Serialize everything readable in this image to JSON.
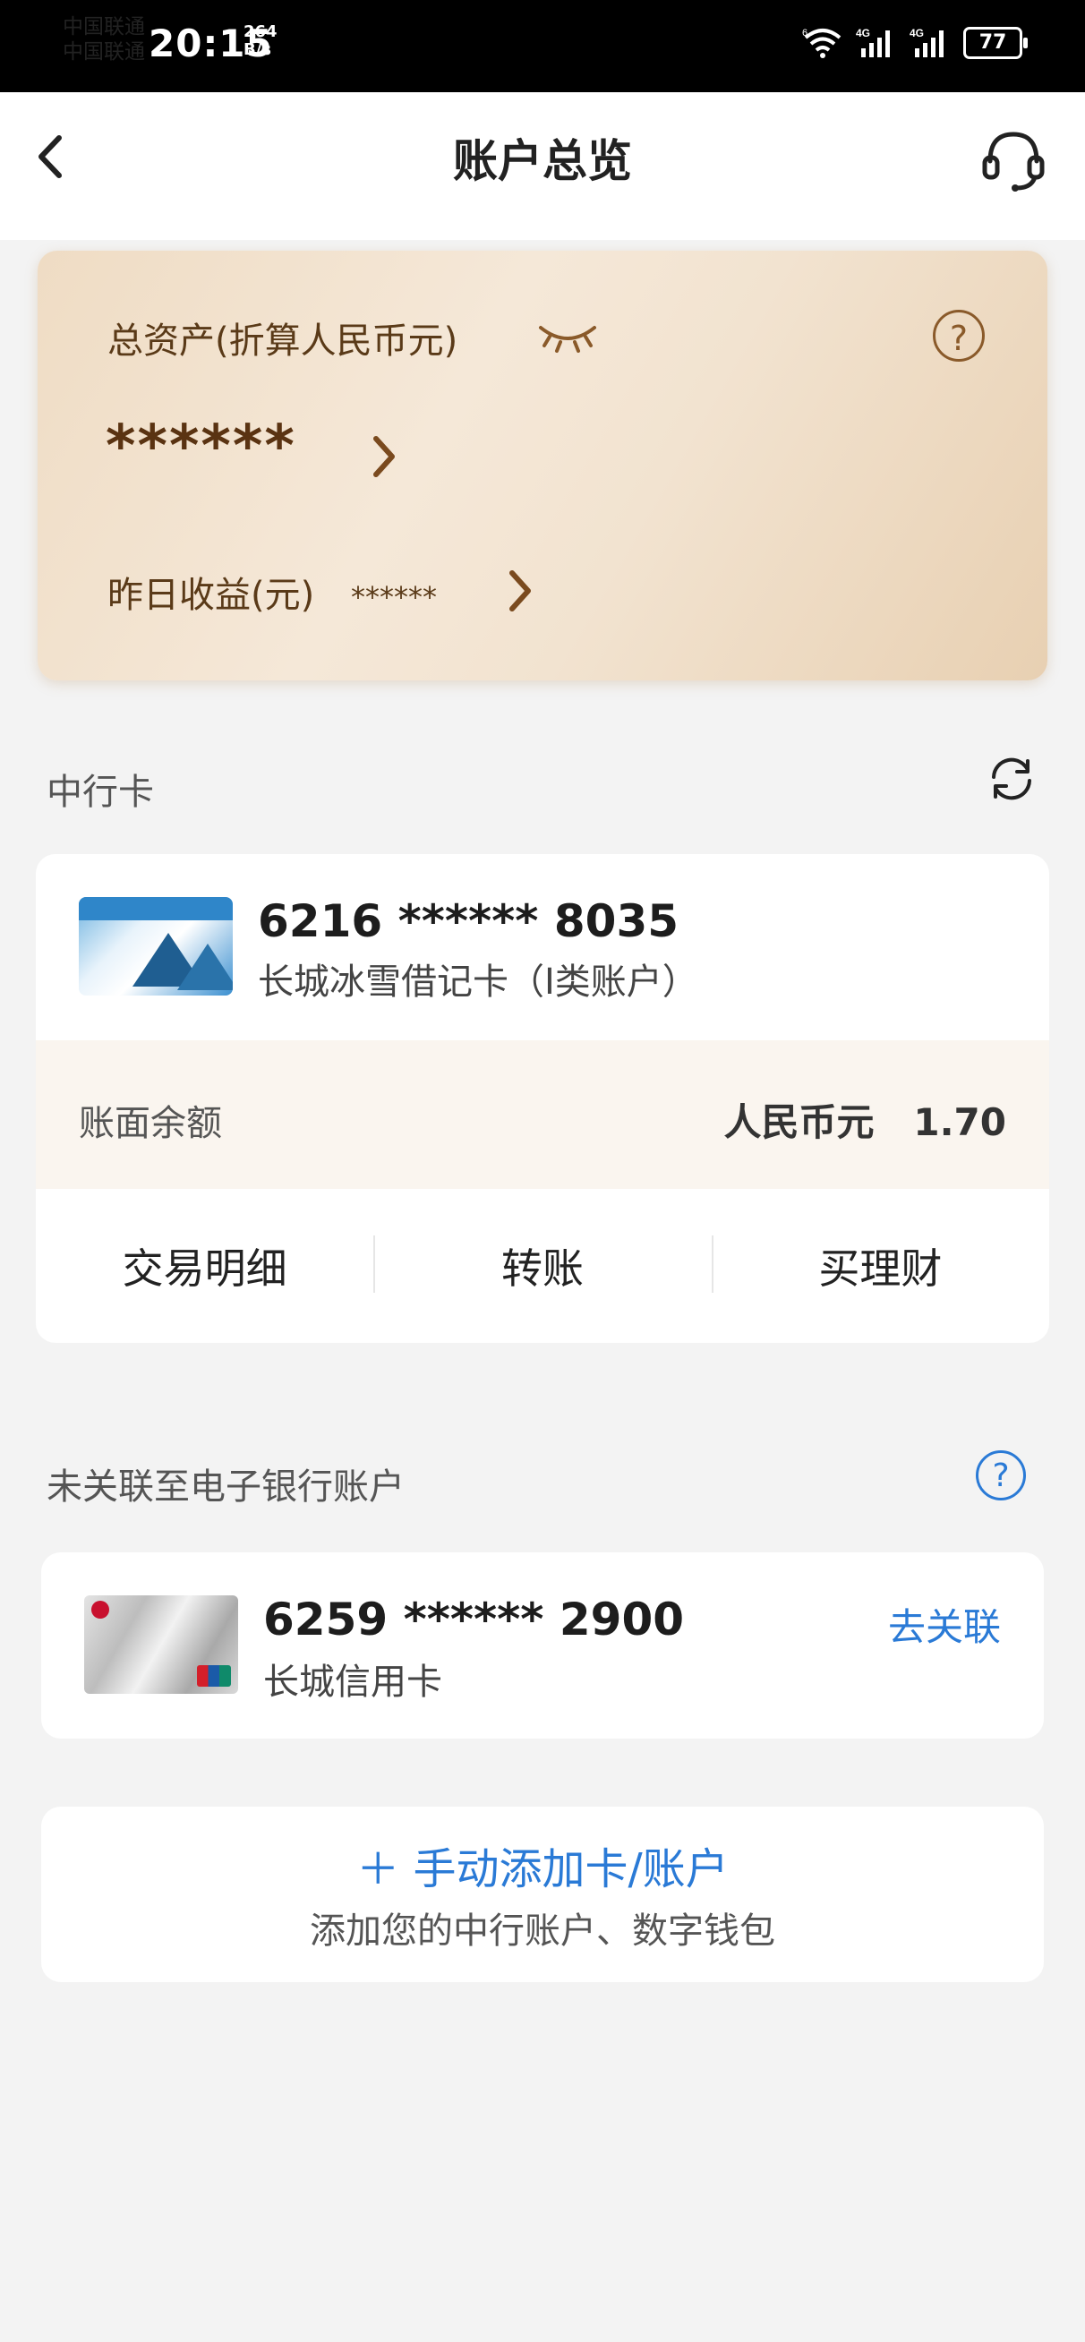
{
  "status_bar": {
    "carrier1": "中国联通",
    "carrier2": "中国联通",
    "time": "20:15",
    "speed_value": "264",
    "speed_unit": "B/s",
    "battery": "77",
    "signal_labels": [
      "6",
      "4G",
      "4G"
    ]
  },
  "header": {
    "title": "账户总览",
    "back_icon": "chevron-left",
    "support_icon": "headset"
  },
  "asset_card": {
    "total_label": "总资产(折算人民币元)",
    "total_amount": "******",
    "yesterday_label": "昨日收益(元)",
    "yesterday_value": "******",
    "help_icon": "?"
  },
  "boc_section": {
    "title": "中行卡",
    "card": {
      "number": "6216 ****** 8035",
      "name": "长城冰雪借记卡（I类账户）",
      "balance_label": "账面余额",
      "currency": "人民币元",
      "balance": "1.70"
    },
    "actions": [
      "交易明细",
      "转账",
      "买理财"
    ]
  },
  "unlinked_section": {
    "title": "未关联至电子银行账户",
    "help_icon": "?",
    "card": {
      "number": "6259 ****** 2900",
      "name": "长城信用卡",
      "link_label": "去关联"
    }
  },
  "add_card": {
    "title": "＋ 手动添加卡/账户",
    "subtitle": "添加您的中行账户、数字钱包"
  },
  "colors": {
    "accent_blue": "#2a7ad6",
    "gold_text": "#5a3a18"
  }
}
